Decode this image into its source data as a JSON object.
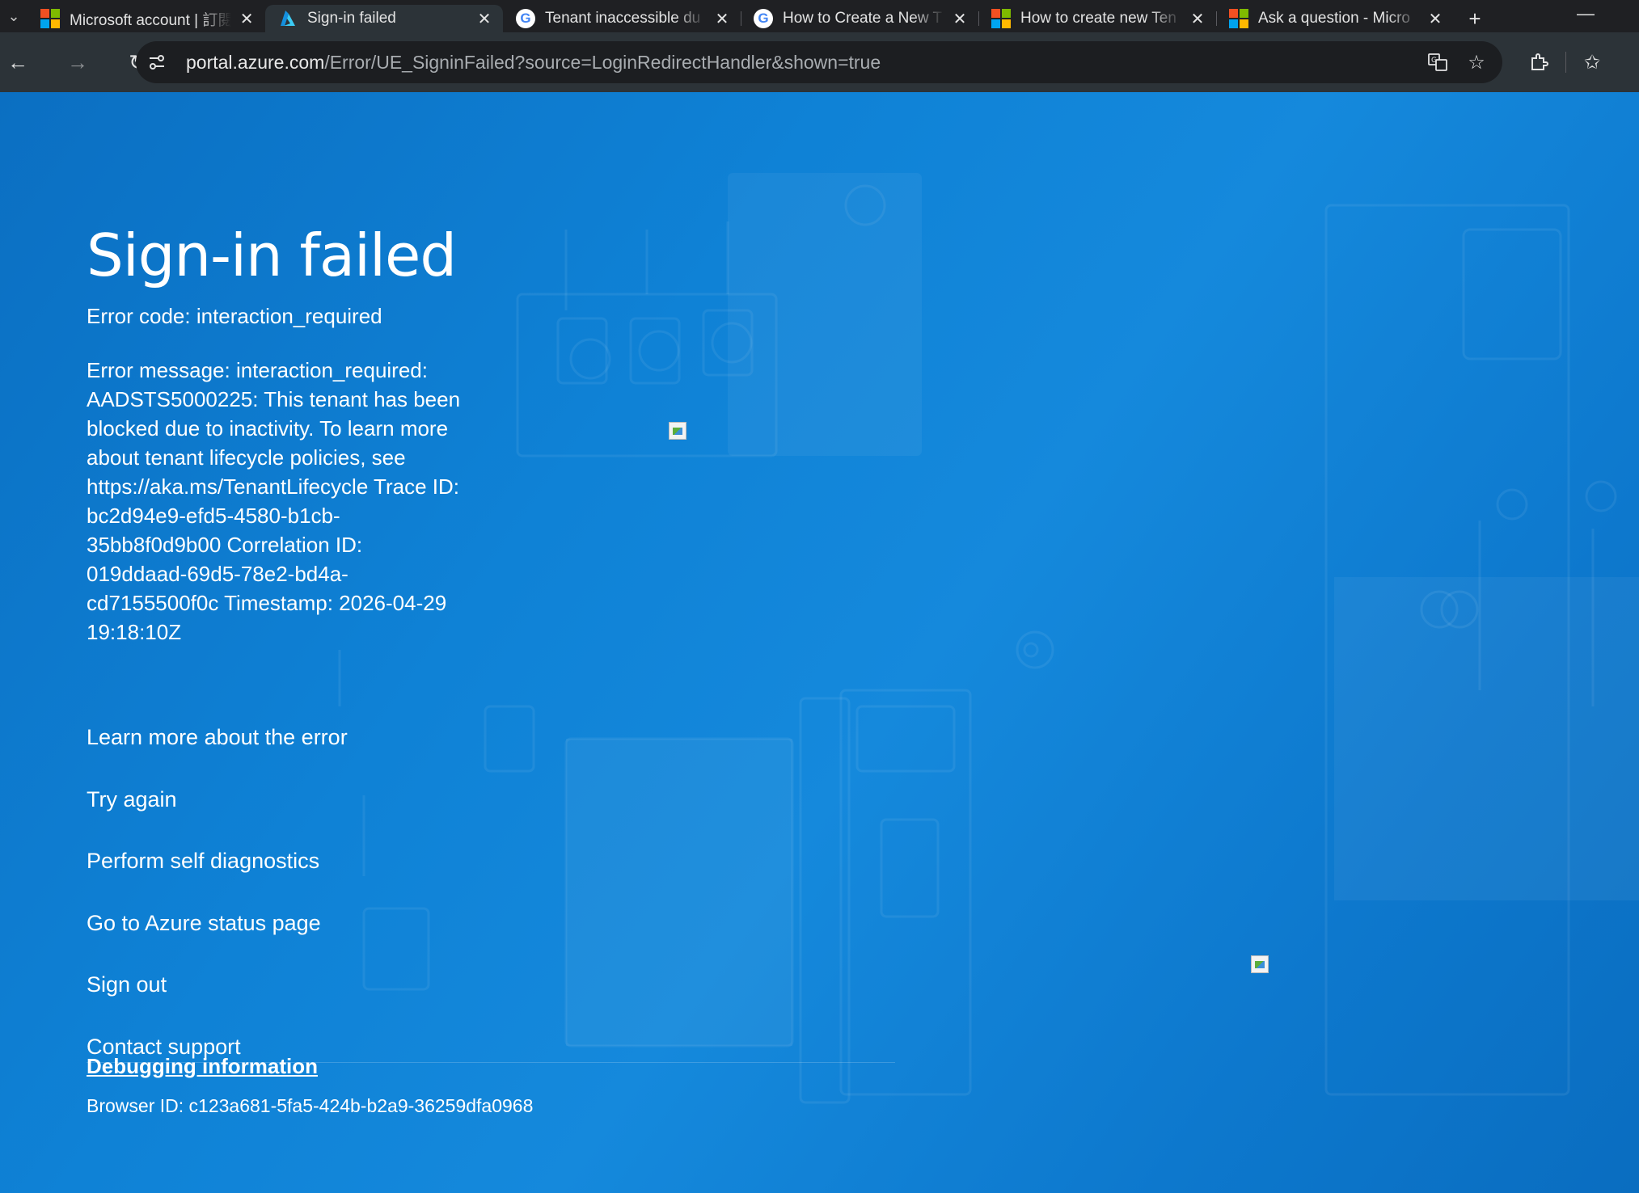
{
  "browser": {
    "tabs": [
      {
        "title": "Microsoft account | 訂閱",
        "icon": "microsoft-icon",
        "active": false
      },
      {
        "title": "Sign-in failed",
        "icon": "azure-icon",
        "active": true
      },
      {
        "title": "Tenant inaccessible du",
        "icon": "google-icon",
        "active": false
      },
      {
        "title": "How to Create a New T",
        "icon": "google-icon",
        "active": false
      },
      {
        "title": "How to create new Ten",
        "icon": "microsoft-icon",
        "active": false
      },
      {
        "title": "Ask a question - Micro",
        "icon": "microsoft-icon",
        "active": false
      }
    ],
    "url_host": "portal.azure.com",
    "url_path": "/Error/UE_SigninFailed?source=LoginRedirectHandler&shown=true"
  },
  "page": {
    "title": "Sign-in failed",
    "error_code": "Error code: interaction_required",
    "error_message": "Error message: interaction_required: AADSTS5000225: This tenant has been blocked due to inactivity. To learn more about tenant lifecycle policies, see https://aka.ms/TenantLifecycle Trace ID: bc2d94e9-efd5-4580-b1cb-35bb8f0d9b00 Correlation ID: 019ddaad-69d5-78e2-bd4a-cd7155500f0c Timestamp: 2026-04-29 19:18:10Z",
    "actions": [
      {
        "label": "Learn more about the error"
      },
      {
        "label": "Try again"
      },
      {
        "label": "Perform self diagnostics"
      },
      {
        "label": "Go to Azure status page"
      },
      {
        "label": "Sign out"
      },
      {
        "label": "Contact support"
      }
    ],
    "debug_title": "Debugging information",
    "browser_id": "Browser ID: c123a681-5fa5-424b-b2a9-36259dfa0968"
  },
  "colors": {
    "page_background": "#0f82d6",
    "text": "#ffffff",
    "chrome_tabbar": "#1f2023",
    "chrome_toolbar": "#2c3338"
  }
}
